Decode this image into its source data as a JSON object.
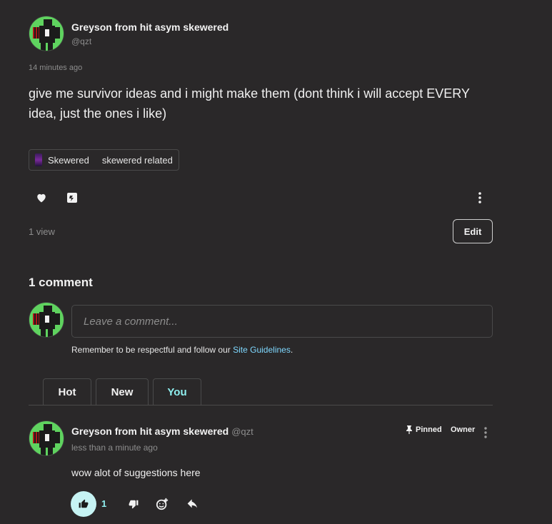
{
  "post": {
    "author_name": "Greyson from hit asym skewered",
    "author_handle": "@qzt",
    "timestamp": "14 minutes ago",
    "body": "give me survivor ideas and i might make them (dont think i will accept EVERY idea, just the ones i like)",
    "tag": {
      "label": "Skewered",
      "description": "skewered related"
    },
    "views": "1 view",
    "edit_label": "Edit"
  },
  "comments_section": {
    "count_label": "1 comment",
    "input_placeholder": "Leave a comment...",
    "guidelines_prefix": "Remember to be respectful and follow our ",
    "guidelines_link": "Site Guidelines",
    "guidelines_suffix": ".",
    "tabs": [
      {
        "label": "Hot"
      },
      {
        "label": "New"
      },
      {
        "label": "You"
      }
    ],
    "active_tab": "You"
  },
  "comment": {
    "author_name": "Greyson from hit asym skewered",
    "author_handle": "@qzt",
    "timestamp": "less than a minute ago",
    "body": "wow alot of suggestions here",
    "pinned_label": "Pinned",
    "owner_label": "Owner",
    "like_count": "1"
  },
  "colors": {
    "background": "#2a2829",
    "accent": "#8ff0f0",
    "link": "#7fd8ff",
    "reaction_active_bg": "#c6f3f3"
  },
  "icons": {
    "like": "heart-icon",
    "gift": "gift-icon",
    "more": "more-vertical-icon",
    "pin": "pin-icon",
    "thumbs_up": "thumbs-up-icon",
    "thumbs_down": "thumbs-down-icon",
    "add_reaction": "add-emoji-icon",
    "reply": "reply-icon"
  }
}
